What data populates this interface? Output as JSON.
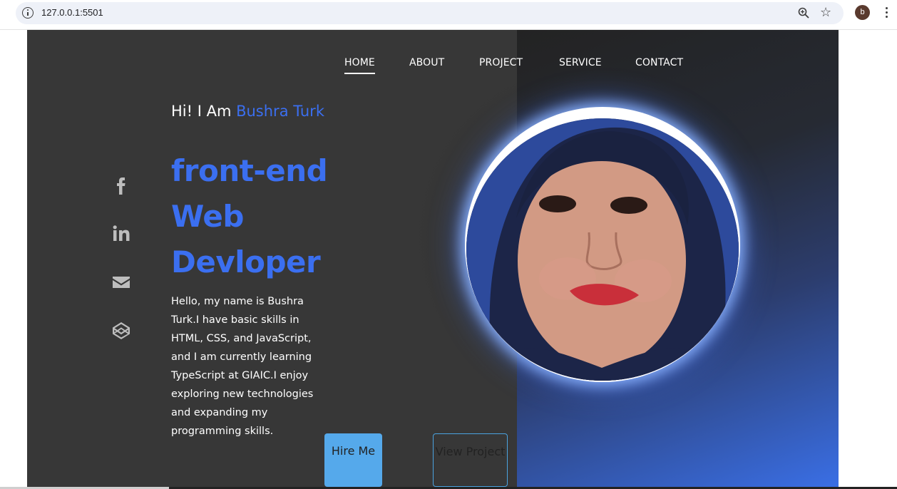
{
  "browser": {
    "url": "127.0.0.1:5501",
    "profile_initial": "b",
    "icons": [
      "info-icon",
      "zoom-icon",
      "star-icon",
      "kebab-menu-icon"
    ]
  },
  "nav": {
    "items": [
      {
        "label": "HOME",
        "active": true
      },
      {
        "label": "ABOUT",
        "active": false
      },
      {
        "label": "PROJECT",
        "active": false
      },
      {
        "label": "SERVICE",
        "active": false
      },
      {
        "label": "CONTACT",
        "active": false
      }
    ]
  },
  "hero": {
    "greeting_prefix": "Hi! I Am ",
    "name": "Bushra Turk",
    "headline": "front-end Web Devloper",
    "bio": "Hello, my name is Bushra Turk.I have basic skills in HTML, CSS, and JavaScript, and I am currently learning TypeScript at GIAIC.I enjoy exploring new technologies and expanding my programming skills.",
    "hire_label": "Hire Me",
    "view_label": "View Project"
  },
  "social": [
    "facebook-icon",
    "linkedin-icon",
    "email-icon",
    "codepen-icon"
  ],
  "colors": {
    "accent": "#3b6ff0",
    "background": "#373737",
    "hire_button": "#55a9eb"
  }
}
